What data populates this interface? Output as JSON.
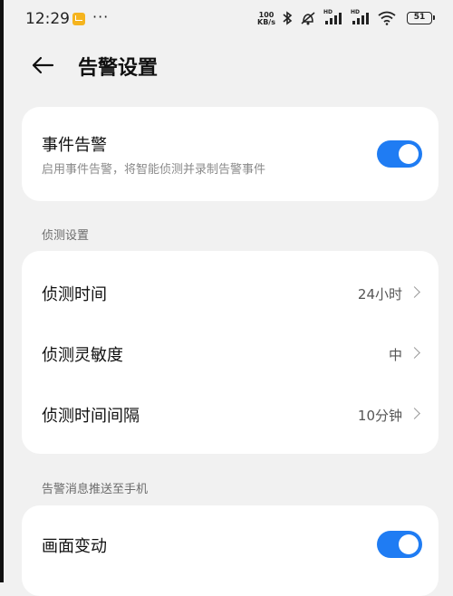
{
  "status_bar": {
    "time": "12:29",
    "more": "···",
    "net_speed_value": "100",
    "net_speed_unit": "KB/s",
    "signal_label": "HD",
    "battery": "51"
  },
  "header": {
    "title": "告警设置"
  },
  "event_alarm": {
    "title": "事件告警",
    "subtitle": "启用事件告警，将智能侦测并录制告警事件",
    "enabled": true
  },
  "detection_settings": {
    "section_label": "侦测设置",
    "items": [
      {
        "label": "侦测时间",
        "value": "24小时"
      },
      {
        "label": "侦测灵敏度",
        "value": "中"
      },
      {
        "label": "侦测时间间隔",
        "value": "10分钟"
      }
    ]
  },
  "push_settings": {
    "section_label": "告警消息推送至手机",
    "items": [
      {
        "label": "画面变动",
        "enabled": true
      }
    ]
  },
  "colors": {
    "accent": "#1f7cf3",
    "background": "#f1f1f1",
    "card": "#ffffff"
  }
}
